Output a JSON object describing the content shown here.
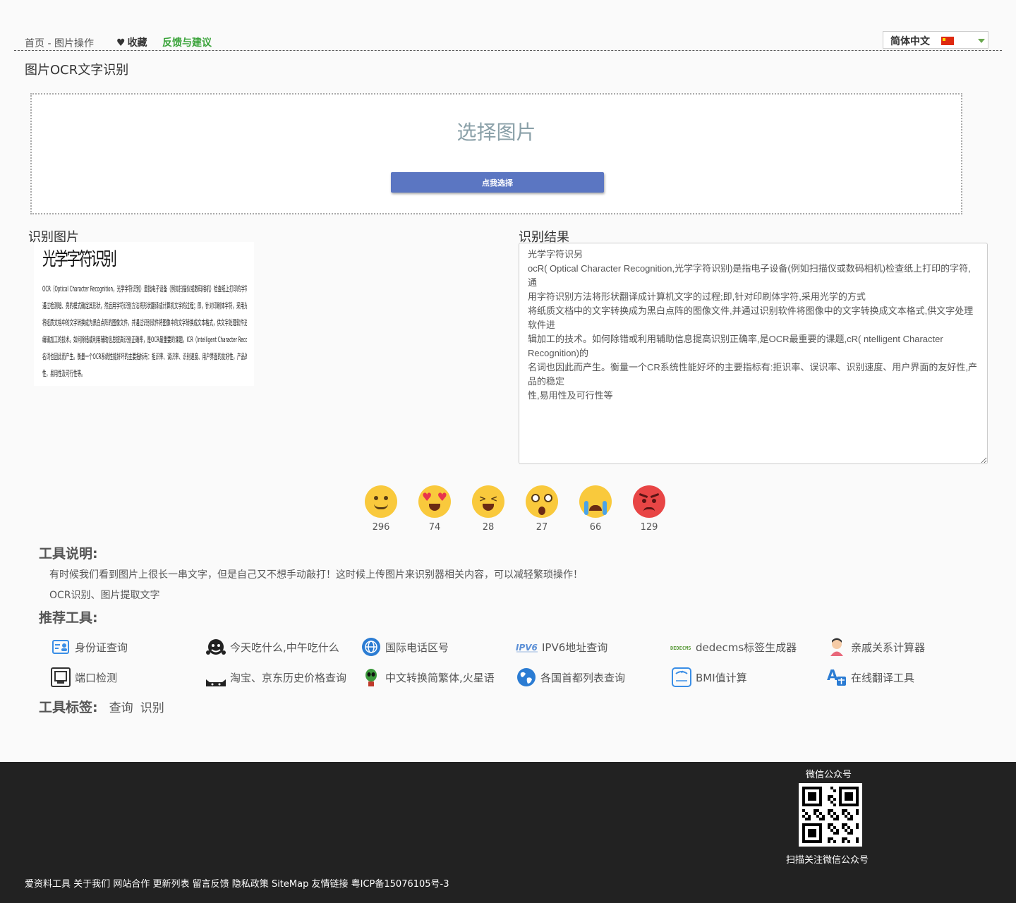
{
  "header": {
    "breadcrumb": "首页 - 图片操作",
    "favorite": "收藏",
    "feedback": "反馈与建议",
    "language": "简体中文"
  },
  "page_title": "图片OCR文字识别",
  "upload": {
    "title": "选择图片",
    "button": "点我选择"
  },
  "labels": {
    "image": "识别图片",
    "result": "识别结果"
  },
  "sample_image": {
    "heading": "光学字符识别",
    "lines": [
      "OCR（Optical Character Recognition，光学字符识别）是指电子设备（例如扫描仪或数码相机）检查纸上打印的字符，",
      "通过检测暗、亮的模式确定其形状，然后用字符识别方法将形状翻译成计算机文字的过程；即，针对印刷体字符，采用光学的方式",
      "将纸质文档中的文字转换成为黑白点阵的图像文件，并通过识别软件将图像中的文字转换成文本格式，供文字处理软件进一步",
      "编辑加工的技术。如何除错或利用辅助信息提高识别正确率，是OCR最重要的课题，ICR（Intelligent Character Recognition）的",
      "名词也因此而产生。衡量一个OCR系统性能好坏的主要指标有：拒识率、误识率、识别速度、用户界面的友好性，产品的稳定",
      "性，易用性及可行性等。"
    ]
  },
  "result_text": [
    "光学字符识另",
    "ocR( Optical Character Recognition,光学字符识别)是指电子设备(例如扫描仪或数码相机)检查纸上打印的字符,通",
    "用字符识别方法将形状翻译成计算机文字的过程;即,针对印刷体字符,采用光学的方式",
    "将纸质文档中的文字转换成为黑白点阵的图像文件,并通过识别软件将图像中的文字转换成文本格式,供文字处理软件进",
    "辑加工的技术。如何除错或利用辅助信息提高识别正确率,是OCR最重要的课题,cR( ntelligent Character Recognition)的",
    "名词也因此而产生。衡量一个CR系统性能好坏的主要指标有:拒识率、误识率、识别速度、用户界面的友好性,产品的稳定",
    "性,易用性及可行性等"
  ],
  "reactions": [
    {
      "icon": "smile-emoji-icon",
      "count": "296"
    },
    {
      "icon": "heart-eyes-emoji-icon",
      "count": "74"
    },
    {
      "icon": "laughing-emoji-icon",
      "count": "28"
    },
    {
      "icon": "astonished-emoji-icon",
      "count": "27"
    },
    {
      "icon": "crying-emoji-icon",
      "count": "66"
    },
    {
      "icon": "angry-emoji-icon",
      "count": "129"
    }
  ],
  "description": {
    "heading": "工具说明:",
    "line1": "有时候我们看到图片上很长一串文字，但是自己又不想手动敲打！这时候上传图片来识别器相关内容，可以减轻繁琐操作！",
    "line2": "OCR识别、图片提取文字"
  },
  "recommended": {
    "heading": "推荐工具:",
    "tools": [
      {
        "label": "身份证查询",
        "icon": "id-card-icon"
      },
      {
        "label": "今天吃什么,中午吃什么",
        "icon": "eating-face-icon"
      },
      {
        "label": "国际电话区号",
        "icon": "globe-phone-icon"
      },
      {
        "label": "IPV6地址查询",
        "icon": "ipv6-icon"
      },
      {
        "label": "dedecms标签生成器",
        "icon": "dedecms-icon"
      },
      {
        "label": "亲戚关系计算器",
        "icon": "relative-person-icon"
      },
      {
        "label": "端口检测",
        "icon": "port-monitor-icon"
      },
      {
        "label": "淘宝、京东历史价格查询",
        "icon": "cat-face-icon"
      },
      {
        "label": "中文转换简繁体,火星语",
        "icon": "alien-icon"
      },
      {
        "label": "各国首都列表查询",
        "icon": "earth-icon"
      },
      {
        "label": "BMI值计算",
        "icon": "scale-icon"
      },
      {
        "label": "在线翻译工具",
        "icon": "translate-icon"
      }
    ]
  },
  "tags": {
    "heading": "工具标签:",
    "items": [
      "查询",
      "识别"
    ]
  },
  "footer": {
    "wechat_title": "微信公众号",
    "qr_caption": "扫描关注微信公众号",
    "links": [
      "爱资料工具",
      "关于我们",
      "网站合作",
      "更新列表",
      "留言反馈",
      "隐私政策",
      "SiteMap",
      "友情链接",
      "粤ICP备15076105号-3"
    ]
  }
}
